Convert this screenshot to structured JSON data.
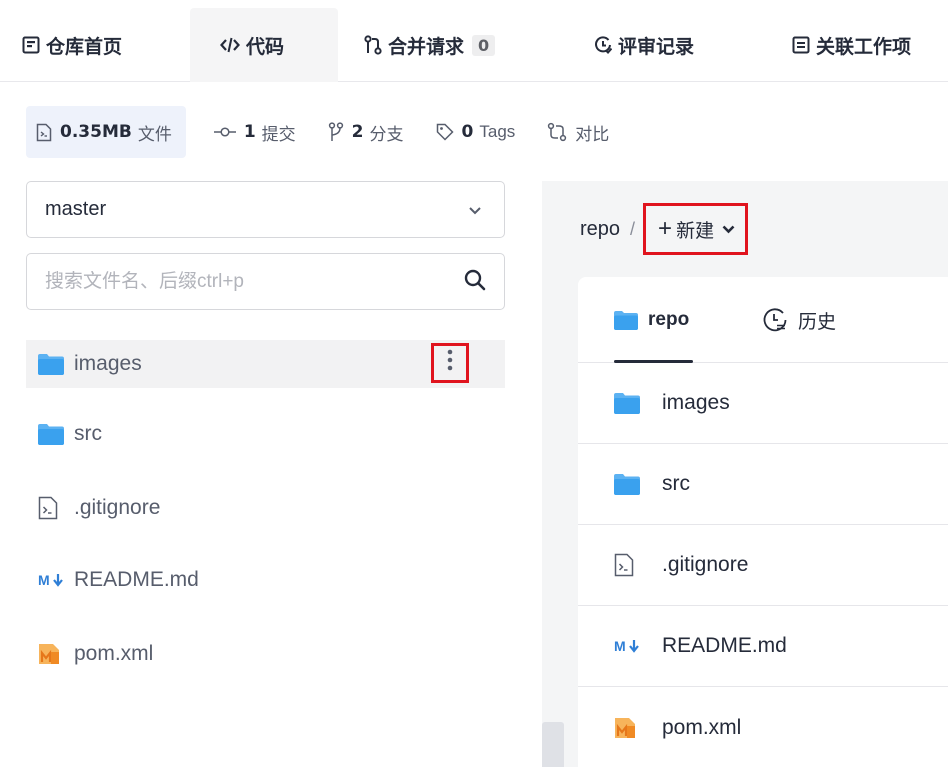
{
  "tabs": [
    {
      "label": "仓库首页",
      "icon": "repo-home-icon"
    },
    {
      "label": "代码",
      "icon": "code-icon",
      "active": true
    },
    {
      "label": "合并请求",
      "icon": "merge-request-icon",
      "badge": "0"
    },
    {
      "label": "评审记录",
      "icon": "review-icon"
    },
    {
      "label": "关联工作项",
      "icon": "work-item-icon"
    }
  ],
  "stats": {
    "size_value": "0.35MB",
    "size_label": "文件",
    "commits_value": "1",
    "commits_label": "提交",
    "branches_value": "2",
    "branches_label": "分支",
    "tags_value": "0",
    "tags_label": "Tags",
    "compare_label": "对比"
  },
  "sidebar": {
    "branch": "master",
    "search_placeholder": "搜索文件名、后缀ctrl+p",
    "files": [
      {
        "name": "images",
        "type": "folder"
      },
      {
        "name": "src",
        "type": "folder"
      },
      {
        "name": ".gitignore",
        "type": "file"
      },
      {
        "name": "README.md",
        "type": "markdown"
      },
      {
        "name": "pom.xml",
        "type": "maven"
      }
    ]
  },
  "main": {
    "crumb_root": "repo",
    "crumb_sep": "/",
    "new_label": "新建",
    "tab_repo": "repo",
    "tab_history": "历史",
    "files": [
      {
        "name": "images",
        "type": "folder"
      },
      {
        "name": "src",
        "type": "folder"
      },
      {
        "name": ".gitignore",
        "type": "file"
      },
      {
        "name": "README.md",
        "type": "markdown"
      },
      {
        "name": "pom.xml",
        "type": "maven"
      }
    ]
  },
  "colors": {
    "folder": "#5cb2f2",
    "markdown": "#2f7fd6",
    "maven": "#f08a24",
    "highlight": "#e0141e"
  }
}
